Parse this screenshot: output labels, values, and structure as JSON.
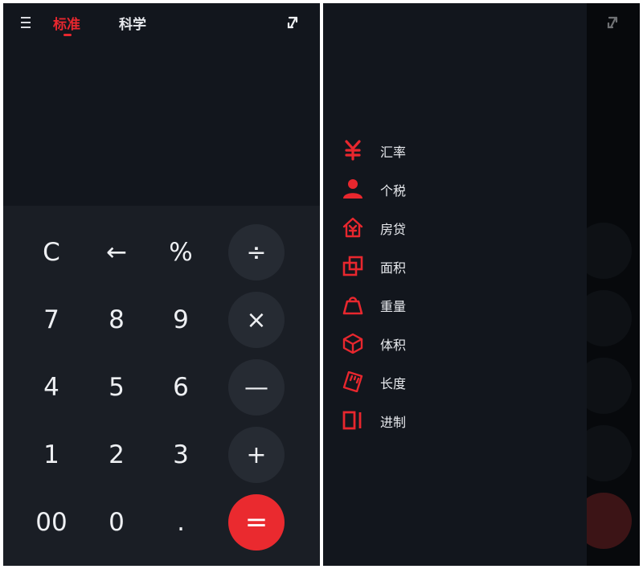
{
  "calculator": {
    "tabs": [
      {
        "label": "标准",
        "active": true
      },
      {
        "label": "科学",
        "active": false
      }
    ],
    "accent_color": "#e8272e",
    "keys": [
      {
        "label": "C",
        "style": "plain"
      },
      {
        "label": "←",
        "style": "plain"
      },
      {
        "label": "%",
        "style": "plain"
      },
      {
        "label": "÷",
        "style": "op"
      },
      {
        "label": "7",
        "style": "plain"
      },
      {
        "label": "8",
        "style": "plain"
      },
      {
        "label": "9",
        "style": "plain"
      },
      {
        "label": "×",
        "style": "op"
      },
      {
        "label": "4",
        "style": "plain"
      },
      {
        "label": "5",
        "style": "plain"
      },
      {
        "label": "6",
        "style": "plain"
      },
      {
        "label": "—",
        "style": "op"
      },
      {
        "label": "1",
        "style": "plain"
      },
      {
        "label": "2",
        "style": "plain"
      },
      {
        "label": "3",
        "style": "plain"
      },
      {
        "label": "+",
        "style": "op"
      },
      {
        "label": "00",
        "style": "plain"
      },
      {
        "label": "0",
        "style": "plain"
      },
      {
        "label": ".",
        "style": "plain"
      },
      {
        "label": "=",
        "style": "eq"
      }
    ]
  },
  "drawer": {
    "items": [
      {
        "label": "汇率",
        "icon": "yen-icon"
      },
      {
        "label": "个税",
        "icon": "person-icon"
      },
      {
        "label": "房贷",
        "icon": "house-yen-icon"
      },
      {
        "label": "面积",
        "icon": "area-squares-icon"
      },
      {
        "label": "重量",
        "icon": "weight-icon"
      },
      {
        "label": "体积",
        "icon": "cube-icon"
      },
      {
        "label": "长度",
        "icon": "ruler-icon"
      },
      {
        "label": "进制",
        "icon": "binary-icon"
      }
    ]
  }
}
